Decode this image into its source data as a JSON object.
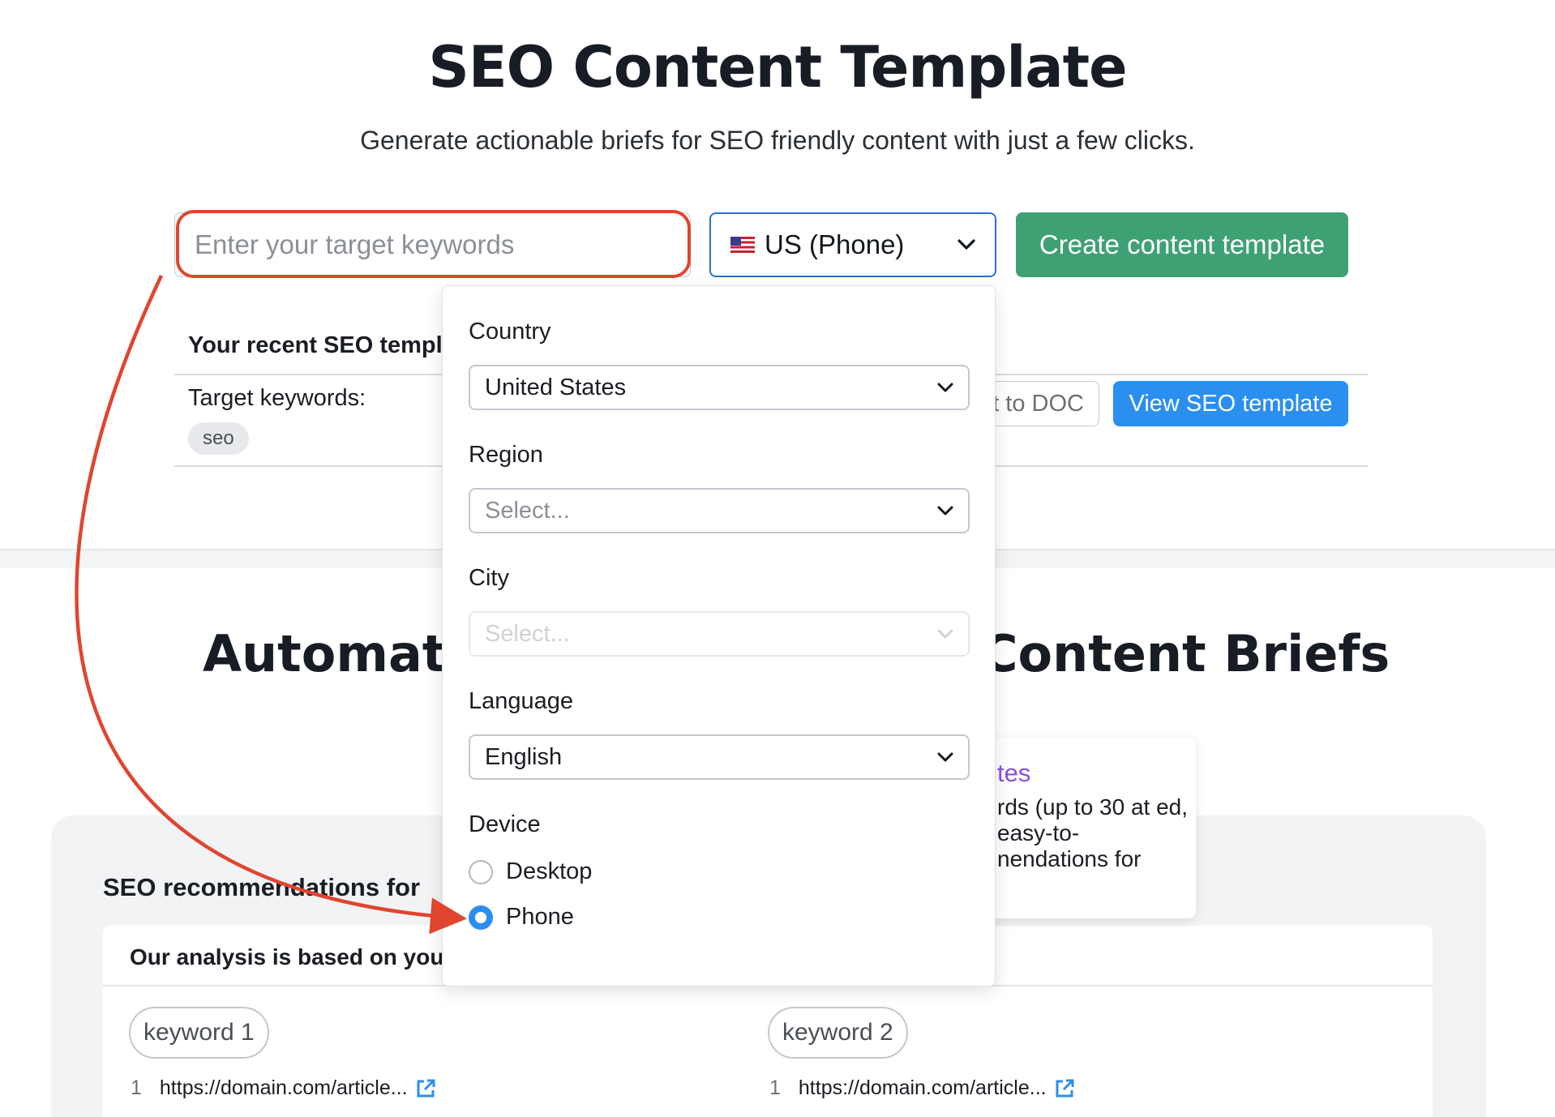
{
  "header": {
    "title": "SEO Content Template",
    "subtitle": "Generate actionable briefs for SEO friendly content with just a few clicks."
  },
  "search": {
    "placeholder": "Enter your target keywords",
    "value": ""
  },
  "database": {
    "label": "US (Phone)",
    "flag": "us-flag-icon"
  },
  "create_button": "Create content template",
  "recent": {
    "title": "Your recent SEO templa",
    "target_label": "Target keywords:",
    "chip": "seo",
    "export_label": "t to DOC",
    "view_label": "View SEO template"
  },
  "popup": {
    "country_label": "Country",
    "country_value": "United States",
    "region_label": "Region",
    "region_placeholder": "Select...",
    "city_label": "City",
    "city_placeholder": "Select...",
    "language_label": "Language",
    "language_value": "English",
    "device_label": "Device",
    "device_options": [
      "Desktop",
      "Phone"
    ],
    "device_selected": "Phone"
  },
  "bottom": {
    "title_left": "Automate",
    "title_right": "Content Briefs",
    "tooltip_head": "tes",
    "tooltip_body": "rds (up to 30 at ed, easy-to- nendations for",
    "rec_title": "SEO recommendations for",
    "analysis": "Our analysis is based on you",
    "keyword1": "keyword 1",
    "keyword2": "keyword 2",
    "url_num": "1",
    "url1": "https://domain.com/article...",
    "url2": "https://domain.com/article..."
  },
  "colors": {
    "accent_green": "#3ea174",
    "accent_blue": "#2b8ff0",
    "highlight_red": "#e0452e",
    "purple": "#8b4fe0"
  }
}
